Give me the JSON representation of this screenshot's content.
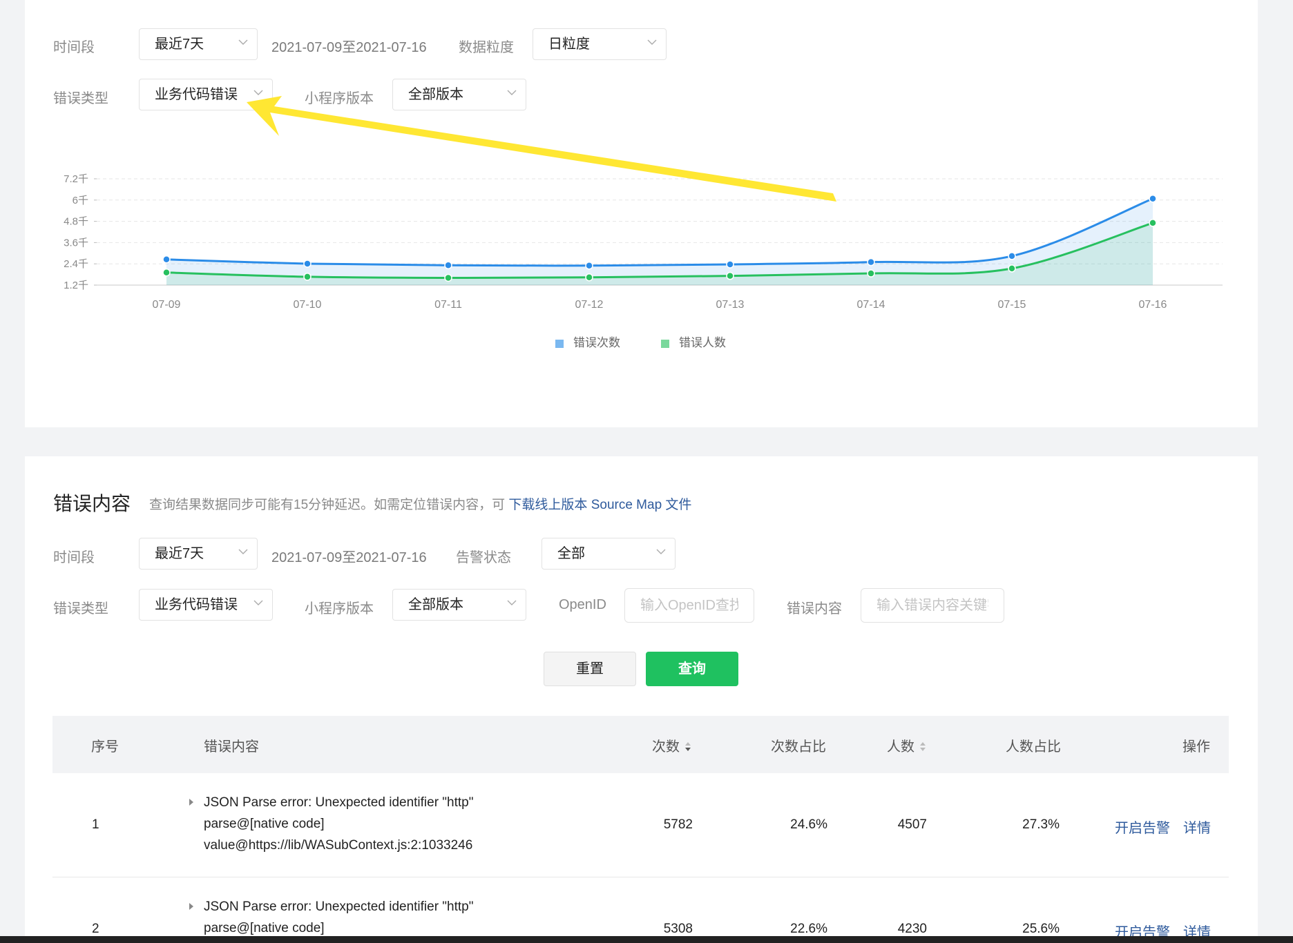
{
  "top_filters": {
    "period_label": "时间段",
    "period_value": "最近7天",
    "date_range": "2021-07-09至2021-07-16",
    "granularity_label": "数据粒度",
    "granularity_value": "日粒度",
    "error_type_label": "错误类型",
    "error_type_value": "业务代码错误",
    "version_label": "小程序版本",
    "version_value": "全部版本"
  },
  "chart_data": {
    "type": "area",
    "categories": [
      "07-09",
      "07-10",
      "07-11",
      "07-12",
      "07-13",
      "07-14",
      "07-15",
      "07-16"
    ],
    "y_ticks": [
      "1.2千",
      "2.4千",
      "3.6千",
      "4.8千",
      "6千",
      "7.2千"
    ],
    "ylim": [
      1200,
      7200
    ],
    "series": [
      {
        "name": "错误次数",
        "color": "#2b8ce8",
        "values": [
          2650,
          2410,
          2320,
          2300,
          2370,
          2500,
          2840,
          6080
        ]
      },
      {
        "name": "错误人数",
        "color": "#27c05f",
        "values": [
          1910,
          1670,
          1610,
          1640,
          1720,
          1860,
          2140,
          4710
        ]
      }
    ],
    "grid": true,
    "legend_position": "bottom"
  },
  "content_section": {
    "title": "错误内容",
    "desc": "查询结果数据同步可能有15分钟延迟。如需定位错误内容，可",
    "link": "下载线上版本 Source Map 文件",
    "period_label": "时间段",
    "period_value": "最近7天",
    "date_range": "2021-07-09至2021-07-16",
    "alert_label": "告警状态",
    "alert_value": "全部",
    "error_type_label": "错误类型",
    "error_type_value": "业务代码错误",
    "version_label": "小程序版本",
    "version_value": "全部版本",
    "openid_label": "OpenID",
    "openid_placeholder": "输入OpenID查找",
    "content_label": "错误内容",
    "content_placeholder": "输入错误内容关键字",
    "reset_label": "重置",
    "query_label": "查询"
  },
  "table": {
    "headers": {
      "index": "序号",
      "content": "错误内容",
      "count": "次数",
      "count_ratio": "次数占比",
      "users": "人数",
      "users_ratio": "人数占比",
      "ops": "操作"
    },
    "rows": [
      {
        "index": "1",
        "lines": [
          "JSON Parse error: Unexpected identifier \"http\"",
          "parse@[native code]",
          "value@https://lib/WASubContext.js:2:1033246"
        ],
        "count": "5782",
        "count_ratio": "24.6%",
        "users": "4507",
        "users_ratio": "27.3%",
        "alert": "开启告警",
        "detail": "详情"
      },
      {
        "index": "2",
        "lines": [
          "JSON Parse error: Unexpected identifier \"http\"",
          "parse@[native code]"
        ],
        "count": "5308",
        "count_ratio": "22.6%",
        "users": "4230",
        "users_ratio": "25.6%",
        "alert": "开启告警",
        "detail": "详情"
      }
    ]
  },
  "colors": {
    "accent_green": "#1fc160",
    "link_blue": "#2e5a9c",
    "annotation_arrow": "#ffe733"
  }
}
